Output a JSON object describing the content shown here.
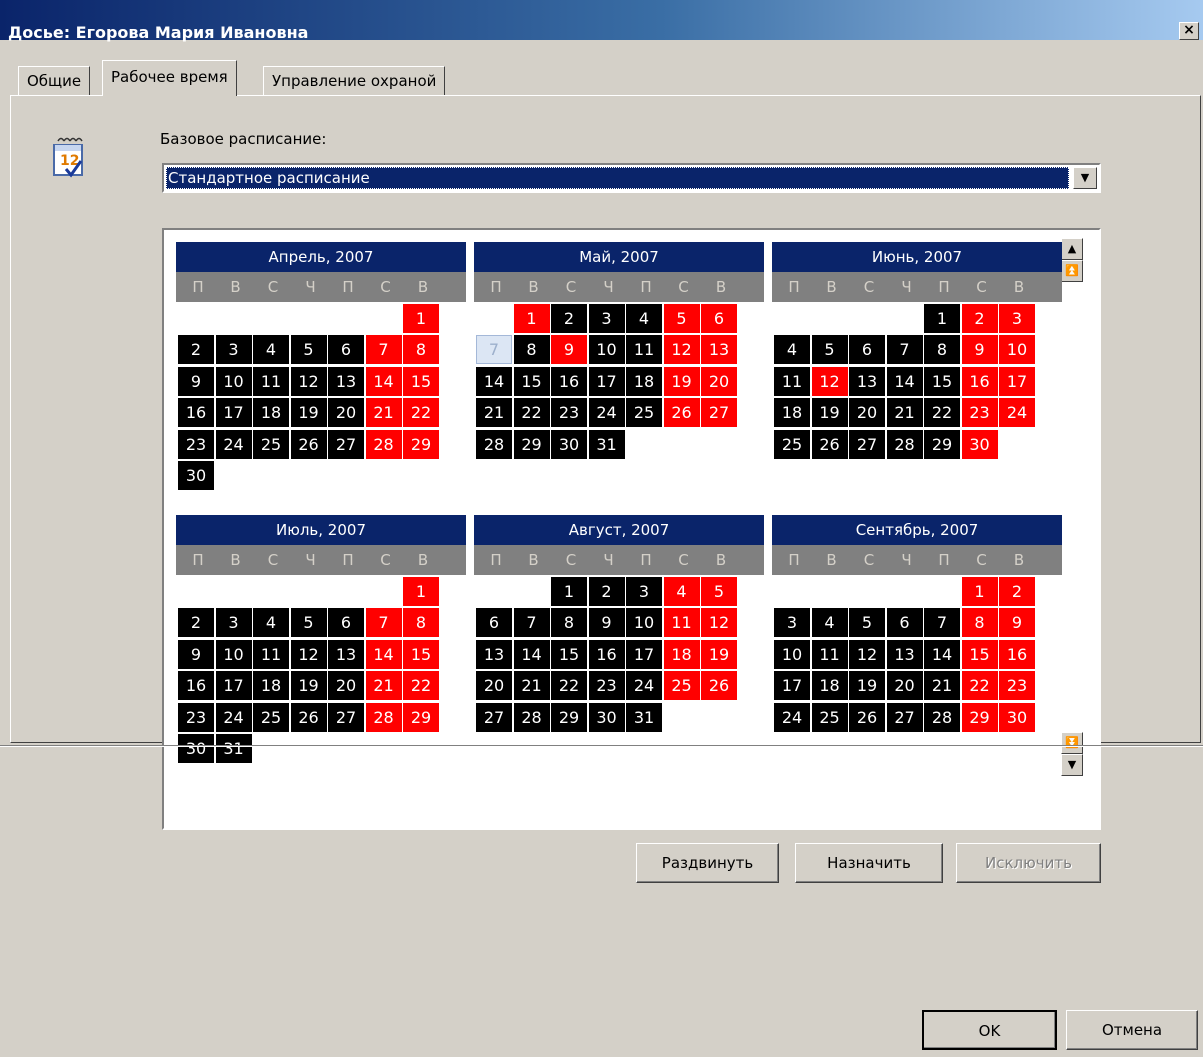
{
  "window": {
    "title": "Досье: Егорова Мария Ивановна",
    "close_glyph": "×"
  },
  "tabs": [
    {
      "label": "Общие",
      "active": false
    },
    {
      "label": "Рабочее время",
      "active": true
    },
    {
      "label": "Управление охраной",
      "active": false
    }
  ],
  "schedule": {
    "label": "Базовое расписание:",
    "value": "Стандартное расписание"
  },
  "weekdays": [
    "П",
    "В",
    "С",
    "Ч",
    "П",
    "С",
    "В"
  ],
  "months": [
    {
      "title": "Апрель, 2007",
      "first_weekday": 6,
      "days": 30,
      "red": [
        1,
        7,
        8,
        14,
        15,
        21,
        22,
        28,
        29
      ],
      "selected": []
    },
    {
      "title": "Май, 2007",
      "first_weekday": 1,
      "days": 31,
      "red": [
        1,
        5,
        6,
        9,
        12,
        13,
        19,
        20,
        26,
        27
      ],
      "selected": [
        7
      ]
    },
    {
      "title": "Июнь, 2007",
      "first_weekday": 4,
      "days": 30,
      "red": [
        2,
        3,
        9,
        10,
        12,
        16,
        17,
        23,
        24,
        30
      ],
      "selected": []
    },
    {
      "title": "Июль, 2007",
      "first_weekday": 6,
      "days": 31,
      "red": [
        1,
        7,
        8,
        14,
        15,
        21,
        22,
        28,
        29
      ],
      "selected": []
    },
    {
      "title": "Август, 2007",
      "first_weekday": 2,
      "days": 31,
      "red": [
        4,
        5,
        11,
        12,
        18,
        19,
        25,
        26
      ],
      "selected": []
    },
    {
      "title": "Сентябрь, 2007",
      "first_weekday": 5,
      "days": 30,
      "red": [
        1,
        2,
        8,
        9,
        15,
        16,
        22,
        23,
        29,
        30
      ],
      "selected": []
    }
  ],
  "buttons": {
    "expand": "Раздвинуть",
    "assign": "Назначить",
    "exclude": "Исключить",
    "ok": "OK",
    "cancel": "Отмена"
  },
  "colors": {
    "workday": "#000000",
    "holiday": "#ff0000",
    "header": "#0a246a",
    "weekday_row": "#808080"
  }
}
